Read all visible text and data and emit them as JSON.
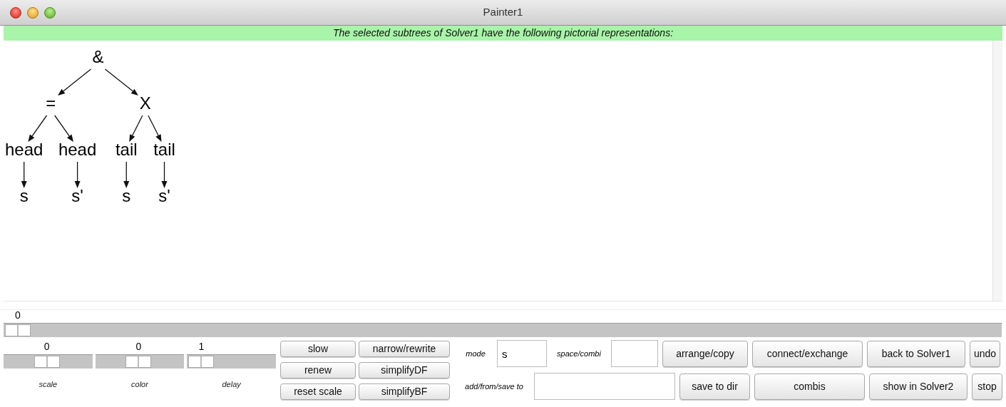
{
  "window": {
    "title": "Painter1"
  },
  "banner": "The selected subtrees of Solver1 have the following pictorial representations:",
  "tree": {
    "label": "&",
    "children": [
      {
        "label": "=",
        "children": [
          {
            "label": "head",
            "children": [
              {
                "label": "s"
              }
            ]
          },
          {
            "label": "head",
            "children": [
              {
                "label": "s'"
              }
            ]
          }
        ]
      },
      {
        "label": "X",
        "children": [
          {
            "label": "tail",
            "children": [
              {
                "label": "s"
              }
            ]
          },
          {
            "label": "tail",
            "children": [
              {
                "label": "s'"
              }
            ]
          }
        ]
      }
    ]
  },
  "main_slider": {
    "value": "0",
    "level": 0
  },
  "sliders": [
    {
      "value": "0",
      "label": "scale",
      "level": 0.48
    },
    {
      "value": "0",
      "label": "color",
      "level": 0.48
    },
    {
      "value": "1",
      "label": "delay",
      "level": 0
    }
  ],
  "buttons": [
    "slow",
    "narrow/rewrite",
    "renew",
    "simplifyDF",
    "reset scale",
    "simplifyBF"
  ],
  "mode": {
    "label": "mode",
    "value": "s"
  },
  "space_combi": {
    "label": "space/combi"
  },
  "add_from_save": {
    "label": "add/from/save to"
  },
  "actions_top": [
    "arrange/copy",
    "connect/exchange",
    "back to Solver1",
    "undo"
  ],
  "actions_bottom": [
    "save to dir",
    "combis",
    "show in Solver2",
    "stop"
  ]
}
